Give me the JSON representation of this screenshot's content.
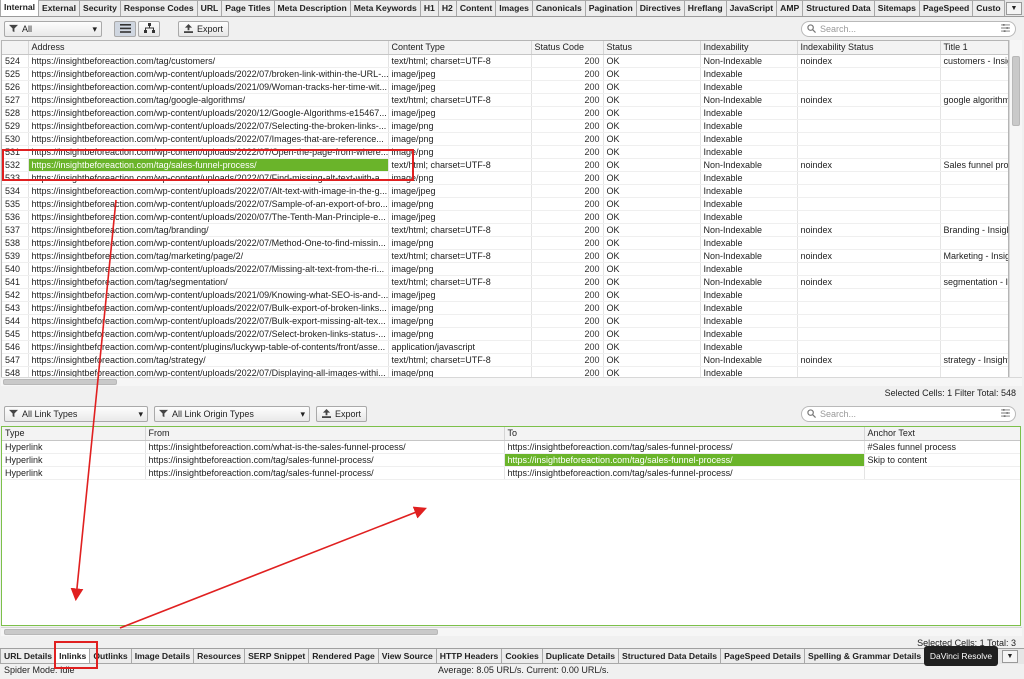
{
  "top_tabs": [
    "Internal",
    "External",
    "Security",
    "Response Codes",
    "URL",
    "Page Titles",
    "Meta Description",
    "Meta Keywords",
    "H1",
    "H2",
    "Content",
    "Images",
    "Canonicals",
    "Pagination",
    "Directives",
    "Hreflang",
    "JavaScript",
    "AMP",
    "Structured Data",
    "Sitemaps",
    "PageSpeed",
    "Custo"
  ],
  "filter": {
    "value": "All"
  },
  "export_label": "Export",
  "search_placeholder": "Search...",
  "main_table": {
    "columns": [
      "",
      "Address",
      "Content Type",
      "Status Code",
      "Status",
      "Indexability",
      "Indexability Status",
      "Title 1"
    ],
    "rows": [
      [
        "524",
        "https://insightbeforeaction.com/tag/customers/",
        "text/html; charset=UTF-8",
        "200",
        "OK",
        "Non-Indexable",
        "noindex",
        "customers - Insight"
      ],
      [
        "525",
        "https://insightbeforeaction.com/wp-content/uploads/2022/07/broken-link-within-the-URL-...",
        "image/jpeg",
        "200",
        "OK",
        "Indexable",
        "",
        ""
      ],
      [
        "526",
        "https://insightbeforeaction.com/wp-content/uploads/2021/09/Woman-tracks-her-time-wit...",
        "image/jpeg",
        "200",
        "OK",
        "Indexable",
        "",
        ""
      ],
      [
        "527",
        "https://insightbeforeaction.com/tag/google-algorithms/",
        "text/html; charset=UTF-8",
        "200",
        "OK",
        "Non-Indexable",
        "noindex",
        "google algorithms -"
      ],
      [
        "528",
        "https://insightbeforeaction.com/wp-content/uploads/2020/12/Google-Algorithms-e15467...",
        "image/jpeg",
        "200",
        "OK",
        "Indexable",
        "",
        ""
      ],
      [
        "529",
        "https://insightbeforeaction.com/wp-content/uploads/2022/07/Selecting-the-broken-links-...",
        "image/png",
        "200",
        "OK",
        "Indexable",
        "",
        ""
      ],
      [
        "530",
        "https://insightbeforeaction.com/wp-content/uploads/2022/07/Images-that-are-reference...",
        "image/png",
        "200",
        "OK",
        "Indexable",
        "",
        ""
      ],
      [
        "531",
        "https://insightbeforeaction.com/wp-content/uploads/2022/07/Open-the-page-from-where...",
        "image/png",
        "200",
        "OK",
        "Indexable",
        "",
        ""
      ],
      [
        "532",
        "https://insightbeforeaction.com/tag/sales-funnel-process/",
        "text/html; charset=UTF-8",
        "200",
        "OK",
        "Non-Indexable",
        "noindex",
        "Sales funnel proce"
      ],
      [
        "533",
        "https://insightbeforeaction.com/wp-content/uploads/2022/07/Find-missing-alt-text-with-a...",
        "image/png",
        "200",
        "OK",
        "Indexable",
        "",
        ""
      ],
      [
        "534",
        "https://insightbeforeaction.com/wp-content/uploads/2022/07/Alt-text-with-image-in-the-g...",
        "image/jpeg",
        "200",
        "OK",
        "Indexable",
        "",
        ""
      ],
      [
        "535",
        "https://insightbeforeaction.com/wp-content/uploads/2022/07/Sample-of-an-export-of-bro...",
        "image/png",
        "200",
        "OK",
        "Indexable",
        "",
        ""
      ],
      [
        "536",
        "https://insightbeforeaction.com/wp-content/uploads/2020/07/The-Tenth-Man-Principle-e...",
        "image/jpeg",
        "200",
        "OK",
        "Indexable",
        "",
        ""
      ],
      [
        "537",
        "https://insightbeforeaction.com/tag/branding/",
        "text/html; charset=UTF-8",
        "200",
        "OK",
        "Non-Indexable",
        "noindex",
        "Branding - Insight"
      ],
      [
        "538",
        "https://insightbeforeaction.com/wp-content/uploads/2022/07/Method-One-to-find-missin...",
        "image/png",
        "200",
        "OK",
        "Indexable",
        "",
        ""
      ],
      [
        "539",
        "https://insightbeforeaction.com/tag/marketing/page/2/",
        "text/html; charset=UTF-8",
        "200",
        "OK",
        "Non-Indexable",
        "noindex",
        "Marketing - Insigh"
      ],
      [
        "540",
        "https://insightbeforeaction.com/wp-content/uploads/2022/07/Missing-alt-text-from-the-ri...",
        "image/png",
        "200",
        "OK",
        "Indexable",
        "",
        ""
      ],
      [
        "541",
        "https://insightbeforeaction.com/tag/segmentation/",
        "text/html; charset=UTF-8",
        "200",
        "OK",
        "Non-Indexable",
        "noindex",
        "segmentation - Ins"
      ],
      [
        "542",
        "https://insightbeforeaction.com/wp-content/uploads/2021/09/Knowing-what-SEO-is-and-...",
        "image/jpeg",
        "200",
        "OK",
        "Indexable",
        "",
        ""
      ],
      [
        "543",
        "https://insightbeforeaction.com/wp-content/uploads/2022/07/Bulk-export-of-broken-links...",
        "image/png",
        "200",
        "OK",
        "Indexable",
        "",
        ""
      ],
      [
        "544",
        "https://insightbeforeaction.com/wp-content/uploads/2022/07/Bulk-export-missing-alt-tex...",
        "image/png",
        "200",
        "OK",
        "Indexable",
        "",
        ""
      ],
      [
        "545",
        "https://insightbeforeaction.com/wp-content/uploads/2022/07/Select-broken-links-status-...",
        "image/png",
        "200",
        "OK",
        "Indexable",
        "",
        ""
      ],
      [
        "546",
        "https://insightbeforeaction.com/wp-content/plugins/luckywp-table-of-contents/front/asse...",
        "application/javascript",
        "200",
        "OK",
        "Indexable",
        "",
        ""
      ],
      [
        "547",
        "https://insightbeforeaction.com/tag/strategy/",
        "text/html; charset=UTF-8",
        "200",
        "OK",
        "Non-Indexable",
        "noindex",
        "strategy - Insight B"
      ],
      [
        "548",
        "https://insightbeforeaction.com/wp-content/uploads/2022/07/Displaying-all-images-withi...",
        "image/png",
        "200",
        "OK",
        "Indexable",
        "",
        ""
      ]
    ],
    "selected_row": 8
  },
  "main_status": "Selected Cells:  1  Filter Total:  548",
  "link_filters": {
    "type": "All Link Types",
    "origin": "All Link Origin Types"
  },
  "inlinks_table": {
    "columns": [
      "Type",
      "From",
      "To",
      "Anchor Text"
    ],
    "rows": [
      [
        "Hyperlink",
        "https://insightbeforeaction.com/what-is-the-sales-funnel-process/",
        "https://insightbeforeaction.com/tag/sales-funnel-process/",
        "#Sales funnel process"
      ],
      [
        "Hyperlink",
        "https://insightbeforeaction.com/tag/sales-funnel-process/",
        "https://insightbeforeaction.com/tag/sales-funnel-process/",
        "Skip to content"
      ],
      [
        "Hyperlink",
        "https://insightbeforeaction.com/tag/sales-funnel-process/",
        "https://insightbeforeaction.com/tag/sales-funnel-process/",
        ""
      ]
    ]
  },
  "inlinks_status": "Selected Cells:  1  Total:  3",
  "bottom_tabs": [
    "URL Details",
    "Inlinks",
    "Outlinks",
    "Image Details",
    "Resources",
    "SERP Snippet",
    "Rendered Page",
    "View Source",
    "HTTP Headers",
    "Cookies",
    "Duplicate Details",
    "Structured Data Details",
    "PageSpeed Details",
    "Spelling & Grammar Details"
  ],
  "footer": {
    "mode": "Spider Mode: Idle",
    "rate": "Average: 8.05 URL/s. Current: 0.00 URL/s."
  },
  "tooltip": "DaVinci Resolve",
  "colors": {
    "highlight": "#6ab42a",
    "annotation": "#e02020"
  }
}
